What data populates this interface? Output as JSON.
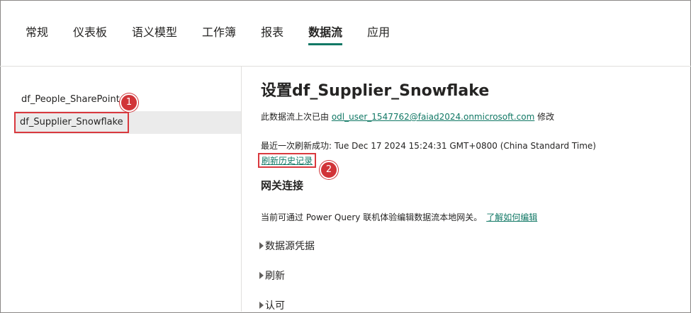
{
  "tabs": [
    {
      "label": "常规"
    },
    {
      "label": "仪表板"
    },
    {
      "label": "语义模型"
    },
    {
      "label": "工作簿"
    },
    {
      "label": "报表"
    },
    {
      "label": "数据流",
      "active": true
    },
    {
      "label": "应用"
    }
  ],
  "sidebar": {
    "items": [
      {
        "label": "df_People_SharePoint"
      },
      {
        "label": "df_Supplier_Snowflake",
        "selected": true
      }
    ]
  },
  "badges": {
    "one": "1",
    "two": "2"
  },
  "panel": {
    "title": "设置df_Supplier_Snowflake",
    "modified_prefix": "此数据流上次已由 ",
    "modified_user": "odl_user_1547762@faiad2024.onmicrosoft.com",
    "modified_suffix": " 修改",
    "refresh_status": "最近一次刷新成功: Tue Dec 17 2024 15:24:31 GMT+0800 (China Standard Time)",
    "history_link": "刷新历史记录",
    "gateway_title": "网关连接",
    "gateway_text": "当前可通过 Power Query 联机体验编辑数据流本地网关。",
    "gateway_link": "了解如何编辑",
    "sections": [
      "数据源凭据",
      "刷新",
      "认可"
    ]
  },
  "colors": {
    "accent": "#117865",
    "highlight": "#d9393e",
    "badge": "#d13438"
  }
}
